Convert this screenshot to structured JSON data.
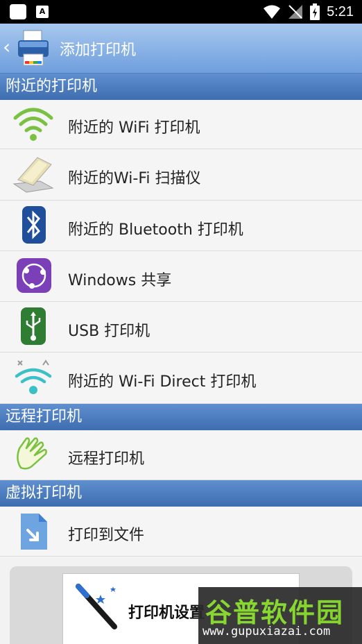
{
  "status_bar": {
    "time": "5:21",
    "notification_badge": "A"
  },
  "app_bar": {
    "back_icon": "‹",
    "title": "添加打印机"
  },
  "sections": [
    {
      "header": "附近的打印机",
      "items": [
        {
          "label": "附近的 WiFi 打印机",
          "icon": "wifi-icon"
        },
        {
          "label": "附近的Wi-Fi 扫描仪",
          "icon": "scanner-icon"
        },
        {
          "label": "附近的 Bluetooth 打印机",
          "icon": "bluetooth-icon"
        },
        {
          "label": "Windows 共享",
          "icon": "share-icon"
        },
        {
          "label": "USB 打印机",
          "icon": "usb-icon"
        },
        {
          "label": "附近的 Wi-Fi Direct 打印机",
          "icon": "wifi-direct-icon"
        }
      ]
    },
    {
      "header": "远程打印机",
      "items": [
        {
          "label": "远程打印机",
          "icon": "hand-wave-icon"
        }
      ]
    },
    {
      "header": "虚拟打印机",
      "items": [
        {
          "label": "打印到文件",
          "icon": "file-export-icon"
        }
      ]
    }
  ],
  "bottom_button": {
    "label": "打印机设置",
    "icon": "magic-wand-icon"
  },
  "watermark": {
    "title": "谷普软件园",
    "url": "www.gupuxiazai.com"
  },
  "colors": {
    "section_header": "#4a78bb",
    "app_bar": "#8ab3e6",
    "wifi_green": "#7ac143",
    "wifi_direct_teal": "#3cc0c8"
  }
}
